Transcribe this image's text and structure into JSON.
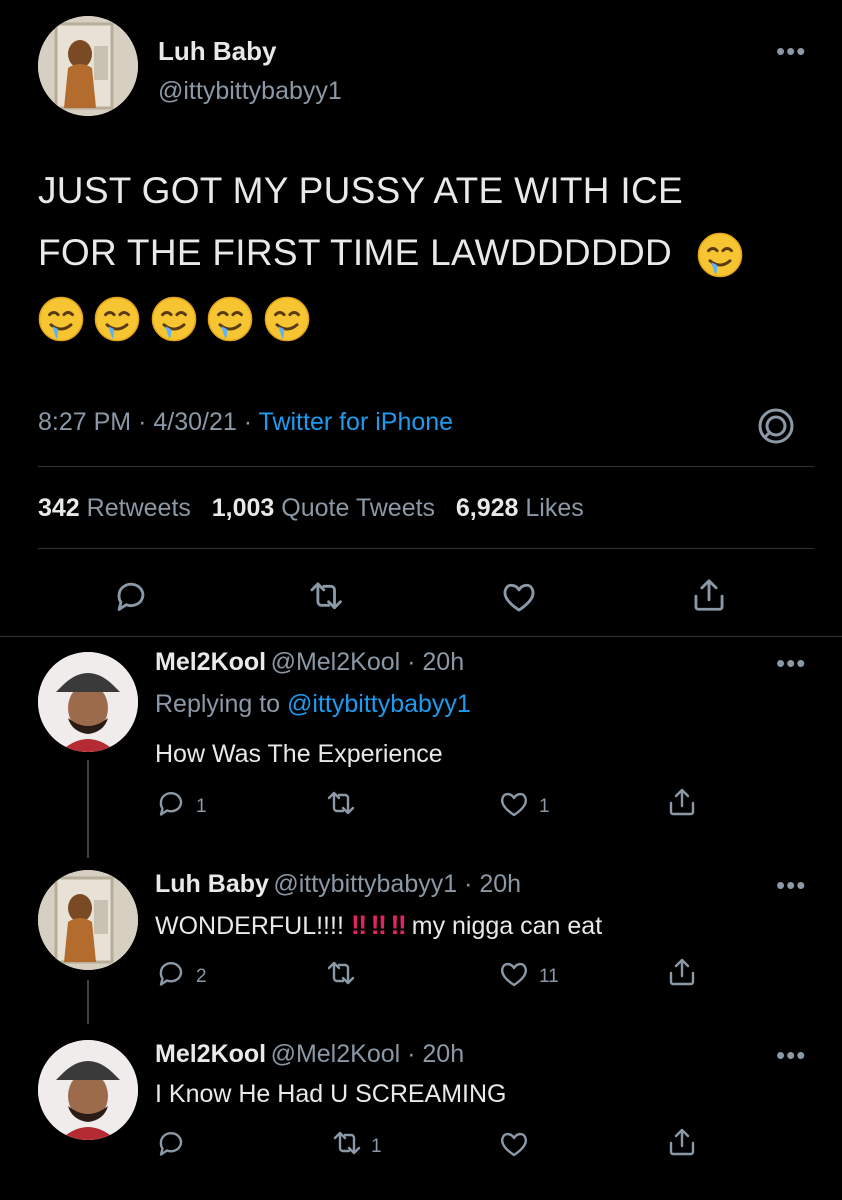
{
  "main_tweet": {
    "display_name": "Luh Baby",
    "handle": "@ittybittybabyy1",
    "text_line1": "JUST GOT MY PUSSY ATE WITH ICE",
    "text_line2": "FOR THE FIRST TIME LAWDDDDDD",
    "emoji_name": "drooling-face",
    "time": "8:27 PM",
    "date": "4/30/21",
    "sep": "·",
    "source": "Twitter for iPhone",
    "stats": {
      "retweets_count": "342",
      "retweets_label": "Retweets",
      "quotes_count": "1,003",
      "quotes_label": "Quote Tweets",
      "likes_count": "6,928",
      "likes_label": "Likes"
    }
  },
  "replies": [
    {
      "display_name": "Mel2Kool",
      "handle_time": "@Mel2Kool · 20h",
      "replying_prefix": "Replying to",
      "replying_handle": "@ittybittybabyy1",
      "text": "How Was The Experience",
      "reply_count": "1",
      "retweet_count": "",
      "like_count": "1"
    },
    {
      "display_name": "Luh Baby",
      "handle_time": "@ittybittybabyy1 · 20h",
      "text_start": "WONDERFUL!!!!",
      "text_bangs": "‼ ‼ ‼",
      "text_end": "my nigga can eat",
      "reply_count": "2",
      "retweet_count": "",
      "like_count": "11"
    },
    {
      "display_name": "Mel2Kool",
      "handle_time": "@Mel2Kool · 20h",
      "text": "I Know He Had U SCREAMING",
      "reply_count": "",
      "retweet_count": "1",
      "like_count": ""
    }
  ],
  "icons": {
    "more": "more-icon",
    "reply": "reply-icon",
    "retweet": "retweet-icon",
    "like": "like-icon",
    "share": "share-icon",
    "analytics": "analytics-icon"
  },
  "colors": {
    "background": "#000000",
    "text": "#e7e9ea",
    "muted": "#8b98a5",
    "link": "#1d9bf0",
    "divider": "#2f3336"
  }
}
